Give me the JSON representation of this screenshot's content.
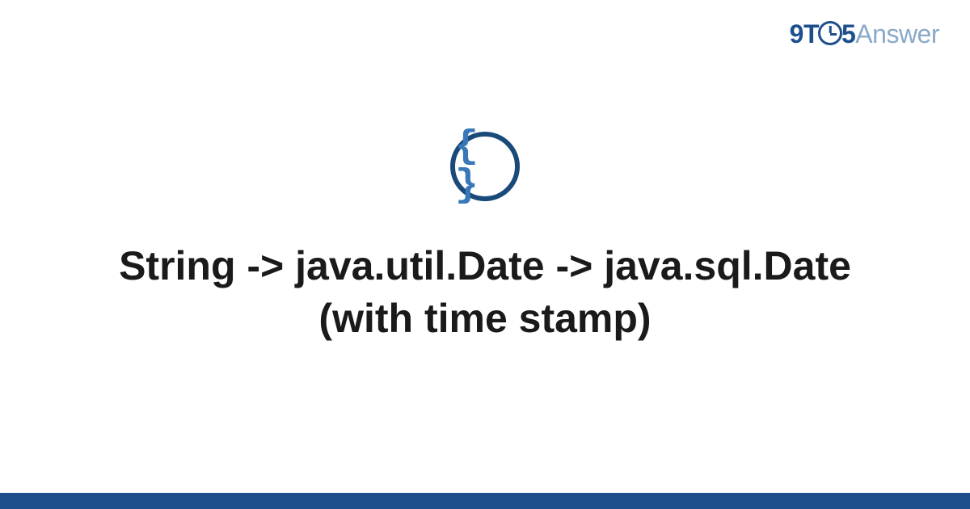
{
  "logo": {
    "prefix": "9T",
    "digit": "5",
    "suffix": "Answer"
  },
  "icon": {
    "name": "code-braces-icon",
    "content": "{ }"
  },
  "title": "String -> java.util.Date -> java.sql.Date (with time stamp)",
  "colors": {
    "brand_primary": "#1d4f8c",
    "brand_light": "#8aa8c9",
    "icon_border": "#1a4a7a",
    "icon_fill": "#3878b8",
    "text": "#1a1a1a",
    "background": "#ffffff"
  }
}
